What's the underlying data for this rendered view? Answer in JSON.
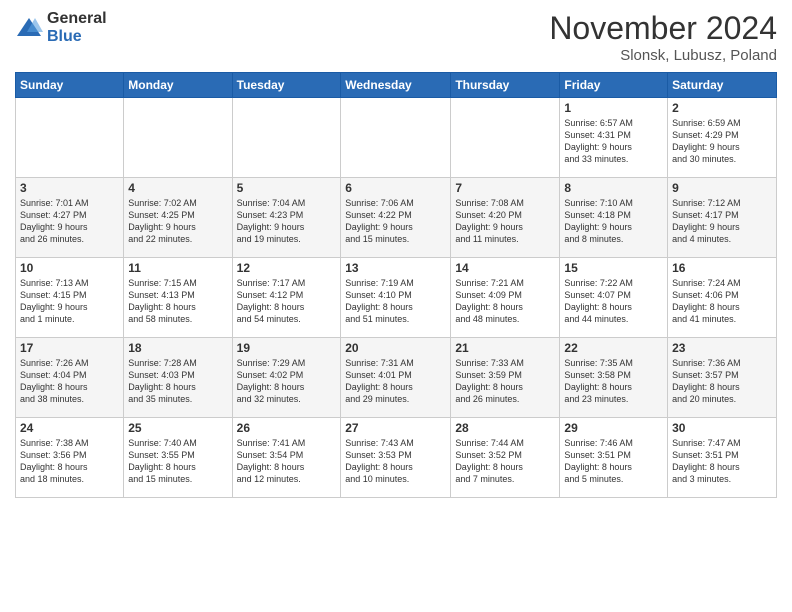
{
  "logo": {
    "general": "General",
    "blue": "Blue"
  },
  "title": "November 2024",
  "location": "Slonsk, Lubusz, Poland",
  "weekdays": [
    "Sunday",
    "Monday",
    "Tuesday",
    "Wednesday",
    "Thursday",
    "Friday",
    "Saturday"
  ],
  "weeks": [
    [
      {
        "day": "",
        "content": ""
      },
      {
        "day": "",
        "content": ""
      },
      {
        "day": "",
        "content": ""
      },
      {
        "day": "",
        "content": ""
      },
      {
        "day": "",
        "content": ""
      },
      {
        "day": "1",
        "content": "Sunrise: 6:57 AM\nSunset: 4:31 PM\nDaylight: 9 hours\nand 33 minutes."
      },
      {
        "day": "2",
        "content": "Sunrise: 6:59 AM\nSunset: 4:29 PM\nDaylight: 9 hours\nand 30 minutes."
      }
    ],
    [
      {
        "day": "3",
        "content": "Sunrise: 7:01 AM\nSunset: 4:27 PM\nDaylight: 9 hours\nand 26 minutes."
      },
      {
        "day": "4",
        "content": "Sunrise: 7:02 AM\nSunset: 4:25 PM\nDaylight: 9 hours\nand 22 minutes."
      },
      {
        "day": "5",
        "content": "Sunrise: 7:04 AM\nSunset: 4:23 PM\nDaylight: 9 hours\nand 19 minutes."
      },
      {
        "day": "6",
        "content": "Sunrise: 7:06 AM\nSunset: 4:22 PM\nDaylight: 9 hours\nand 15 minutes."
      },
      {
        "day": "7",
        "content": "Sunrise: 7:08 AM\nSunset: 4:20 PM\nDaylight: 9 hours\nand 11 minutes."
      },
      {
        "day": "8",
        "content": "Sunrise: 7:10 AM\nSunset: 4:18 PM\nDaylight: 9 hours\nand 8 minutes."
      },
      {
        "day": "9",
        "content": "Sunrise: 7:12 AM\nSunset: 4:17 PM\nDaylight: 9 hours\nand 4 minutes."
      }
    ],
    [
      {
        "day": "10",
        "content": "Sunrise: 7:13 AM\nSunset: 4:15 PM\nDaylight: 9 hours\nand 1 minute."
      },
      {
        "day": "11",
        "content": "Sunrise: 7:15 AM\nSunset: 4:13 PM\nDaylight: 8 hours\nand 58 minutes."
      },
      {
        "day": "12",
        "content": "Sunrise: 7:17 AM\nSunset: 4:12 PM\nDaylight: 8 hours\nand 54 minutes."
      },
      {
        "day": "13",
        "content": "Sunrise: 7:19 AM\nSunset: 4:10 PM\nDaylight: 8 hours\nand 51 minutes."
      },
      {
        "day": "14",
        "content": "Sunrise: 7:21 AM\nSunset: 4:09 PM\nDaylight: 8 hours\nand 48 minutes."
      },
      {
        "day": "15",
        "content": "Sunrise: 7:22 AM\nSunset: 4:07 PM\nDaylight: 8 hours\nand 44 minutes."
      },
      {
        "day": "16",
        "content": "Sunrise: 7:24 AM\nSunset: 4:06 PM\nDaylight: 8 hours\nand 41 minutes."
      }
    ],
    [
      {
        "day": "17",
        "content": "Sunrise: 7:26 AM\nSunset: 4:04 PM\nDaylight: 8 hours\nand 38 minutes."
      },
      {
        "day": "18",
        "content": "Sunrise: 7:28 AM\nSunset: 4:03 PM\nDaylight: 8 hours\nand 35 minutes."
      },
      {
        "day": "19",
        "content": "Sunrise: 7:29 AM\nSunset: 4:02 PM\nDaylight: 8 hours\nand 32 minutes."
      },
      {
        "day": "20",
        "content": "Sunrise: 7:31 AM\nSunset: 4:01 PM\nDaylight: 8 hours\nand 29 minutes."
      },
      {
        "day": "21",
        "content": "Sunrise: 7:33 AM\nSunset: 3:59 PM\nDaylight: 8 hours\nand 26 minutes."
      },
      {
        "day": "22",
        "content": "Sunrise: 7:35 AM\nSunset: 3:58 PM\nDaylight: 8 hours\nand 23 minutes."
      },
      {
        "day": "23",
        "content": "Sunrise: 7:36 AM\nSunset: 3:57 PM\nDaylight: 8 hours\nand 20 minutes."
      }
    ],
    [
      {
        "day": "24",
        "content": "Sunrise: 7:38 AM\nSunset: 3:56 PM\nDaylight: 8 hours\nand 18 minutes."
      },
      {
        "day": "25",
        "content": "Sunrise: 7:40 AM\nSunset: 3:55 PM\nDaylight: 8 hours\nand 15 minutes."
      },
      {
        "day": "26",
        "content": "Sunrise: 7:41 AM\nSunset: 3:54 PM\nDaylight: 8 hours\nand 12 minutes."
      },
      {
        "day": "27",
        "content": "Sunrise: 7:43 AM\nSunset: 3:53 PM\nDaylight: 8 hours\nand 10 minutes."
      },
      {
        "day": "28",
        "content": "Sunrise: 7:44 AM\nSunset: 3:52 PM\nDaylight: 8 hours\nand 7 minutes."
      },
      {
        "day": "29",
        "content": "Sunrise: 7:46 AM\nSunset: 3:51 PM\nDaylight: 8 hours\nand 5 minutes."
      },
      {
        "day": "30",
        "content": "Sunrise: 7:47 AM\nSunset: 3:51 PM\nDaylight: 8 hours\nand 3 minutes."
      }
    ]
  ]
}
